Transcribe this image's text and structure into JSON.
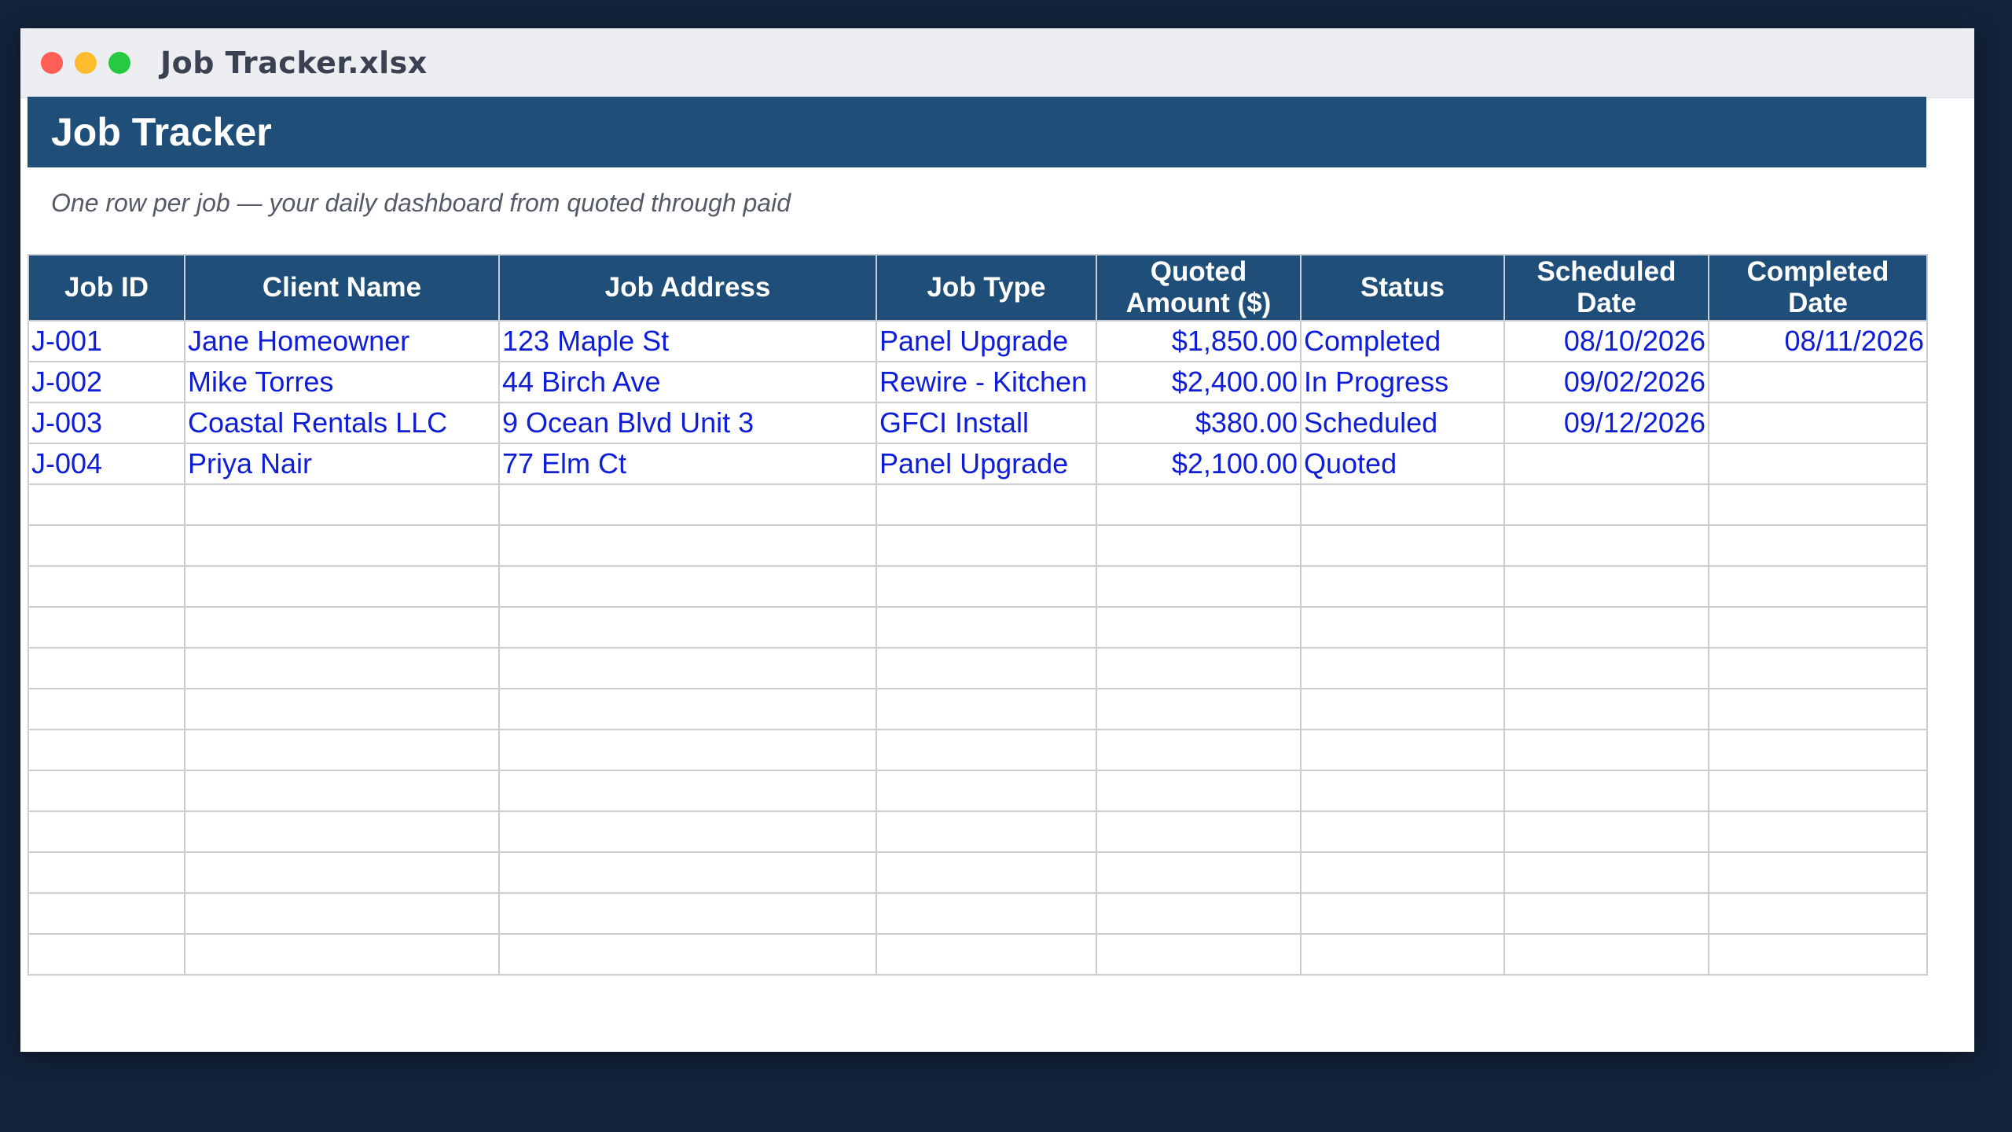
{
  "window": {
    "title": "Job Tracker.xlsx"
  },
  "sheet": {
    "title": "Job Tracker",
    "subtitle": "One row per job — your daily dashboard from quoted through paid"
  },
  "table": {
    "headers": [
      "Job ID",
      "Client Name",
      "Job Address",
      "Job Type",
      "Quoted\nAmount ($)",
      "Status",
      "Scheduled\nDate",
      "Completed\nDate"
    ],
    "rows": [
      [
        "J-001",
        "Jane Homeowner",
        "123 Maple St",
        "Panel Upgrade",
        "$1,850.00",
        "Completed",
        "08/10/2026",
        "08/11/2026"
      ],
      [
        "J-002",
        "Mike Torres",
        "44 Birch Ave",
        "Rewire - Kitchen",
        "$2,400.00",
        "In Progress",
        "09/02/2026",
        ""
      ],
      [
        "J-003",
        "Coastal Rentals LLC",
        "9 Ocean Blvd Unit 3",
        "GFCI Install",
        "$380.00",
        "Scheduled",
        "09/12/2026",
        ""
      ],
      [
        "J-004",
        "Priya Nair",
        "77 Elm Ct",
        "Panel Upgrade",
        "$2,100.00",
        "Quoted",
        "",
        ""
      ]
    ],
    "empty_rows": 12
  },
  "colors": {
    "header_bg": "#1f4e79",
    "cell_text": "#0f1ed6",
    "grid_line": "#c9cdd3",
    "desktop_bg": "#14233b"
  }
}
